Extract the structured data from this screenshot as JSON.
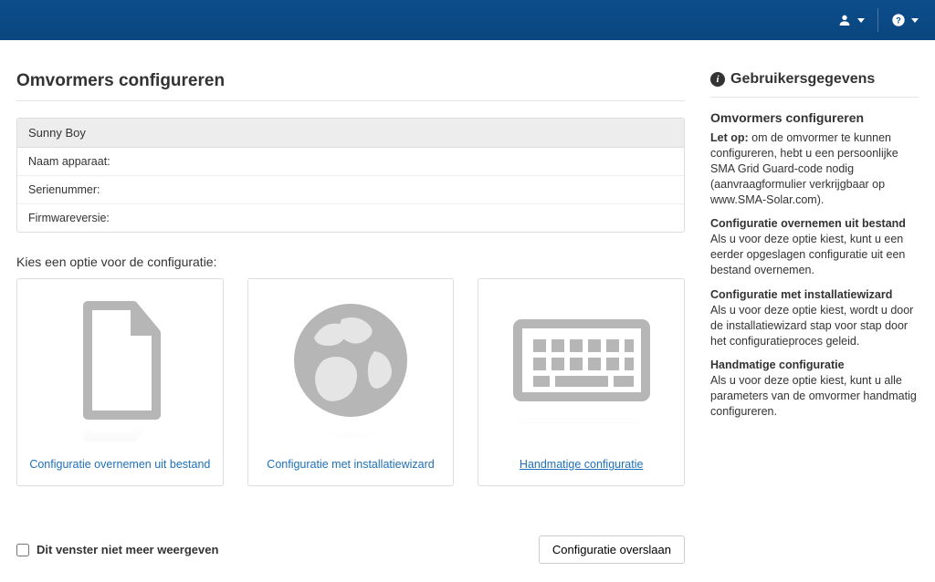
{
  "page": {
    "title": "Omvormers configureren"
  },
  "device": {
    "name": "Sunny Boy",
    "fields": {
      "name_label": "Naam apparaat:",
      "serial_label": "Serienummer:",
      "firmware_label": "Firmwareversie:"
    }
  },
  "prompt": "Kies een optie voor de configuratie:",
  "options": {
    "from_file": "Configuratie overnemen uit bestand",
    "wizard": "Configuratie met installatiewizard",
    "manual": "Handmatige configuratie"
  },
  "footer": {
    "dont_show": "Dit venster niet meer weergeven",
    "skip": "Configuratie overslaan"
  },
  "sidebar": {
    "heading": "Gebruikersgegevens",
    "section_title": "Omvormers configureren",
    "intro_bold": "Let op:",
    "intro_text": " om de omvormer te kunnen configureren, hebt u een persoonlijke SMA Grid Guard-code nodig (aanvraagformulier verkrijgbaar op www.SMA-Solar.com).",
    "opt1_title": "Configuratie overnemen uit bestand",
    "opt1_text": "Als u voor deze optie kiest, kunt u een eerder opgeslagen configuratie uit een bestand overnemen.",
    "opt2_title": "Configuratie met installatiewizard",
    "opt2_text": "Als u voor deze optie kiest, wordt u door de installatiewizard stap voor stap door het configuratieproces geleid.",
    "opt3_title": "Handmatige configuratie",
    "opt3_text": "Als u voor deze optie kiest, kunt u alle parameters van de omvormer handmatig configureren."
  }
}
